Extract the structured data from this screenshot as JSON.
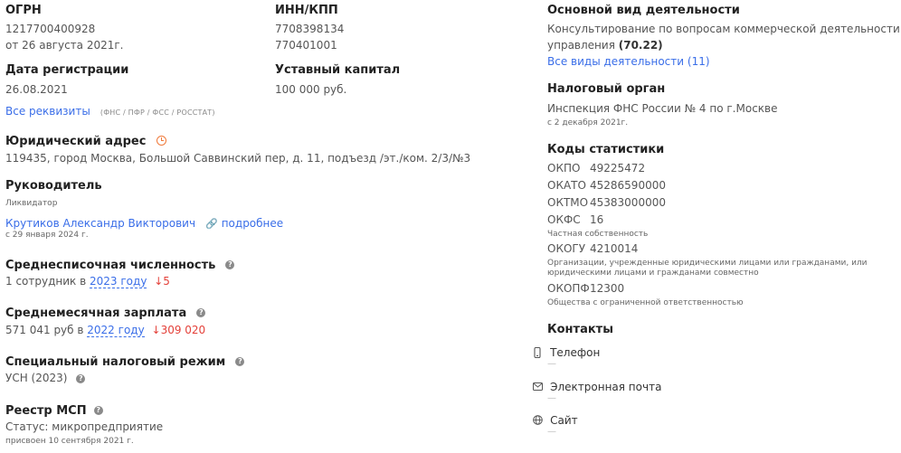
{
  "ogrn": {
    "label": "ОГРН",
    "value": "1217700400928",
    "date": "от 26 августа 2021г."
  },
  "inn": {
    "label": "ИНН/КПП",
    "inn": "7708398134",
    "kpp": "770401001"
  },
  "reg": {
    "label": "Дата регистрации",
    "value": "26.08.2021"
  },
  "capital": {
    "label": "Уставный капитал",
    "value": "100 000 руб."
  },
  "requisites": {
    "link": "Все реквизиты",
    "sub": "(ФНС / ПФР / ФСС / РОССТАТ)"
  },
  "address": {
    "label": "Юридический адрес",
    "value": "119435, город Москва, Большой Саввинский пер, д. 11, подъезд /эт./ком. 2/3/№3"
  },
  "head": {
    "label": "Руководитель",
    "role": "Ликвидатор",
    "name": "Крутиков Александр Викторович",
    "more": "подробнее",
    "since": "с 29 января 2024 г."
  },
  "staff": {
    "label": "Среднесписочная численность",
    "prefix": "1 сотрудник в",
    "year": "2023 году",
    "delta": "↓5"
  },
  "salary": {
    "label": "Среднемесячная зарплата",
    "prefix": "571 041 руб в",
    "year": "2022 году",
    "delta": "↓309 020"
  },
  "tax_regime": {
    "label": "Специальный налоговый режим",
    "value": "УСН (2023)"
  },
  "msp": {
    "label": "Реестр МСП",
    "status": "Статус: микропредприятие",
    "since": "присвоен 10 сентября 2021 г."
  },
  "activity": {
    "label": "Основной вид деятельности",
    "line1": "Консультирование по вопросам коммерческой деятельности и",
    "line2": "управления",
    "code": "(70.22)",
    "all_link": "Все виды деятельности (11)"
  },
  "tax_org": {
    "label": "Налоговый орган",
    "value": "Инспекция ФНС России № 4 по г.Москве",
    "since": "с 2 декабря 2021г."
  },
  "stats": {
    "label": "Коды статистики",
    "okpo": {
      "k": "ОКПО",
      "v": "49225472"
    },
    "okato": {
      "k": "ОКАТО",
      "v": "45286590000"
    },
    "oktmo": {
      "k": "ОКТМО",
      "v": "45383000000"
    },
    "okfs": {
      "k": "ОКФС",
      "v": "16",
      "note": "Частная собственность"
    },
    "okogu": {
      "k": "ОКОГУ",
      "v": "4210014",
      "note1": "Организации, учрежденные юридическими лицами или гражданами, или",
      "note2": "юридическими лицами и гражданами совместно"
    },
    "okopf": {
      "k": "ОКОПФ",
      "v": "12300",
      "note": "Общества с ограниченной ответственностью"
    }
  },
  "contacts": {
    "label": "Контакты",
    "phone": "Телефон",
    "email": "Электронная почта",
    "site": "Сайт",
    "empty": "—"
  }
}
